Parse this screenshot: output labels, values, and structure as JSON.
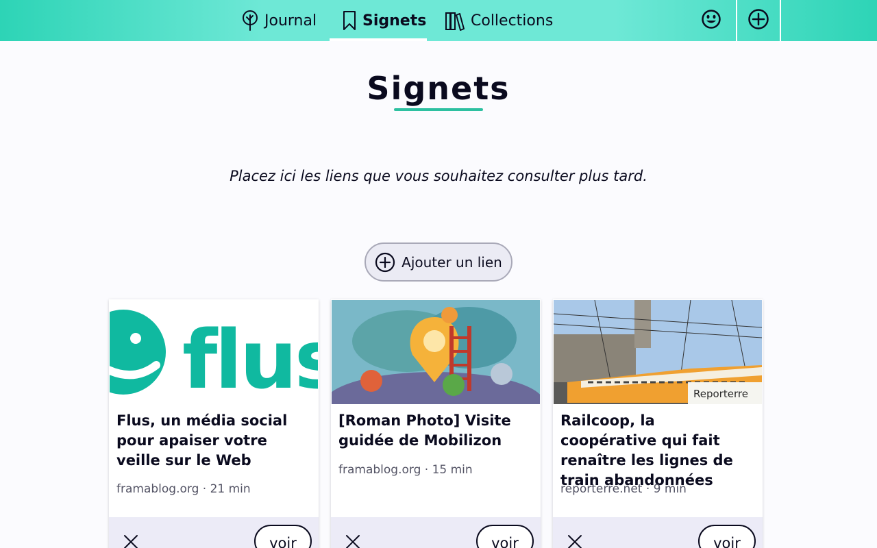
{
  "nav": {
    "journal": "Journal",
    "signets": "Signets",
    "collections": "Collections"
  },
  "header": {
    "profile_icon": "smiley-icon",
    "add_icon": "plus-circle-icon"
  },
  "page": {
    "title": "Signets",
    "intro": "Placez ici les liens que vous souhaitez consulter plus tard.",
    "add_link_label": "Ajouter un lien"
  },
  "cards": [
    {
      "title": "Flus, un média social pour apaiser votre veille sur le Web",
      "meta": "framablog.org · 21 min",
      "remove_icon": "close-icon",
      "open_label": "voir",
      "image_text": "flus"
    },
    {
      "title": "[Roman Photo] Visite guidée de Mobilizon",
      "meta": "framablog.org · 15 min",
      "remove_icon": "close-icon",
      "open_label": "voir"
    },
    {
      "title": "Railcoop, la coopérative qui fait renaître les lignes de train abandonnées",
      "meta": "reporterre.net · 9 min",
      "remove_icon": "close-icon",
      "open_label": "voir",
      "image_text": "Reporterre"
    }
  ],
  "colors": {
    "accent": "#2dd4b6",
    "accent_light": "#6ee8d6",
    "footer_bg": "#ecebf7"
  }
}
